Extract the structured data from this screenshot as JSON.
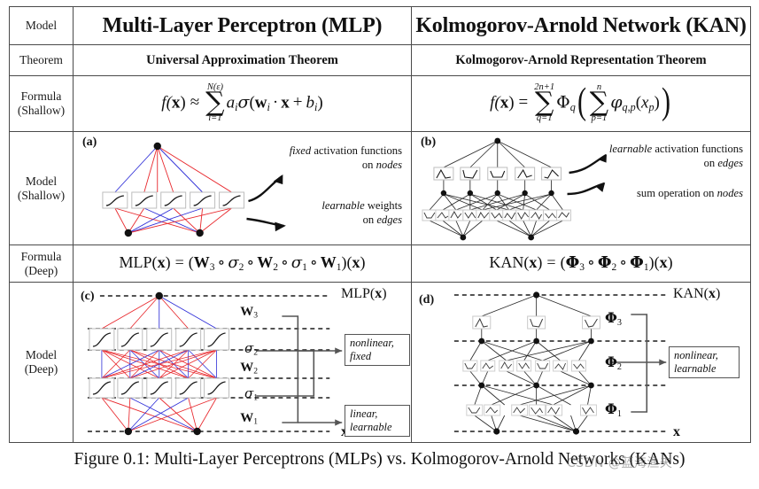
{
  "table": {
    "row_labels": {
      "model": "Model",
      "theorem": "Theorem",
      "formula_shallow_l1": "Formula",
      "formula_shallow_l2": "(Shallow)",
      "model_shallow_l1": "Model",
      "model_shallow_l2": "(Shallow)",
      "formula_deep_l1": "Formula",
      "formula_deep_l2": "(Deep)",
      "model_deep_l1": "Model",
      "model_deep_l2": "(Deep)"
    },
    "headers": {
      "mlp": "Multi-Layer Perceptron (MLP)",
      "kan": "Kolmogorov-Arnold Network (KAN)"
    },
    "theorems": {
      "mlp": "Universal Approximation Theorem",
      "kan": "Kolmogorov-Arnold Representation Theorem"
    },
    "formula_shallow": {
      "mlp_plain": "f(x) ≈ Σ_{i=1}^{N(ε)} a_i σ(w_i · x + b_i)",
      "kan_plain": "f(x) = Σ_{q=1}^{2n+1} Φ_q ( Σ_{p=1}^{n} φ_{q,p}(x_p) )",
      "mlp_parts": {
        "lhs": "f(",
        "lhs_x": "x",
        "lhs_close": ")",
        "rel": "≈",
        "sum_upper": "N(ε)",
        "sum_lower": "i=1",
        "term_a": "a",
        "term_a_sub": "i",
        "sigma": "σ",
        "open": "(",
        "w": "w",
        "w_sub": "i",
        "dot": "·",
        "x": "x",
        "plus": "+",
        "b": "b",
        "b_sub": "i",
        "close": ")"
      },
      "kan_parts": {
        "lhs": "f(",
        "lhs_x": "x",
        "lhs_close": ")",
        "rel": "=",
        "sum1_upper": "2n+1",
        "sum1_lower": "q=1",
        "bigphi": "Φ",
        "bigphi_sub": "q",
        "sum2_upper": "n",
        "sum2_lower": "p=1",
        "smallphi": "φ",
        "smallphi_sub": "q,p",
        "open": "(",
        "inner_x": "x",
        "inner_x_sub": "p",
        "close": ")"
      }
    },
    "formula_deep": {
      "mlp_plain": "MLP(x) = (W₃ ∘ σ₂ ∘ W₂ ∘ σ₁ ∘ W₁)(x)",
      "kan_plain": "KAN(x) = (Φ₃ ∘ Φ₂ ∘ Φ₁)(x)",
      "mlp_parts": {
        "name": "MLP(",
        "arg": "x",
        "name_close": ")",
        "eq": "=",
        "open": "(",
        "w3": "W",
        "w3_sub": "3",
        "comp": "∘",
        "s2": "σ",
        "s2_sub": "2",
        "w2": "W",
        "w2_sub": "2",
        "s1": "σ",
        "s1_sub": "1",
        "w1": "W",
        "w1_sub": "1",
        "close": ")(",
        "tail_x": "x",
        "tail_close": ")"
      },
      "kan_parts": {
        "name": "KAN(",
        "arg": "x",
        "name_close": ")",
        "eq": "=",
        "open": "(",
        "p3": "Φ",
        "p3_sub": "3",
        "comp": "∘",
        "p2": "Φ",
        "p2_sub": "2",
        "p1": "Φ",
        "p1_sub": "1",
        "close": ")(",
        "tail_x": "x",
        "tail_close": ")"
      }
    }
  },
  "panel_a": {
    "tag": "(a)",
    "annotation_top_l1_em": "fixed",
    "annotation_top_l1_rest": " activation functions",
    "annotation_top_l2_pre": "on ",
    "annotation_top_l2_em": "nodes",
    "annotation_bottom_l1_em": "learnable",
    "annotation_bottom_l1_rest": " weights",
    "annotation_bottom_l2_pre": "on ",
    "annotation_bottom_l2_em": "edges"
  },
  "panel_b": {
    "tag": "(b)",
    "annotation_top_l1_em": "learnable",
    "annotation_top_l1_rest": " activation functions",
    "annotation_top_l2_pre": "on ",
    "annotation_top_l2_em": "edges",
    "annotation_bottom_pre": "sum operation on ",
    "annotation_bottom_em": "nodes"
  },
  "panel_c": {
    "tag": "(c)",
    "top_label": "MLP(x)",
    "top_label_name": "MLP(",
    "top_label_arg": "x",
    "top_label_close": ")",
    "bottom_label": "x",
    "layer_labels": [
      {
        "sym": "W",
        "sub": "3"
      },
      {
        "sym": "σ",
        "sub": "2"
      },
      {
        "sym": "W",
        "sub": "2"
      },
      {
        "sym": "σ",
        "sub": "1"
      },
      {
        "sym": "W",
        "sub": "1"
      }
    ],
    "box_nonlinear_l1": "nonlinear,",
    "box_nonlinear_l2": "fixed",
    "box_linear_l1": "linear,",
    "box_linear_l2": "learnable"
  },
  "panel_d": {
    "tag": "(d)",
    "top_label": "KAN(x)",
    "top_label_name": "KAN(",
    "top_label_arg": "x",
    "top_label_close": ")",
    "bottom_label": "x",
    "layer_labels": [
      {
        "sym": "Φ",
        "sub": "3"
      },
      {
        "sym": "Φ",
        "sub": "2"
      },
      {
        "sym": "Φ",
        "sub": "1"
      }
    ],
    "box_nonlinear_l1": "nonlinear,",
    "box_nonlinear_l2": "learnable"
  },
  "caption": {
    "text": "Figure 0.1: Multi-Layer Perceptrons (MLPs) vs. Kolmogorov-Arnold Networks (KANs)"
  },
  "watermark": {
    "text": "CSDN @蓝海渔夫"
  },
  "colors": {
    "edge_red": "#e8272c",
    "edge_blue": "#2f2fd8",
    "node_black": "#111111",
    "box_gray": "#b9b9b9",
    "curve_black": "#1a1a1a",
    "rule": "#4a4a4a"
  }
}
